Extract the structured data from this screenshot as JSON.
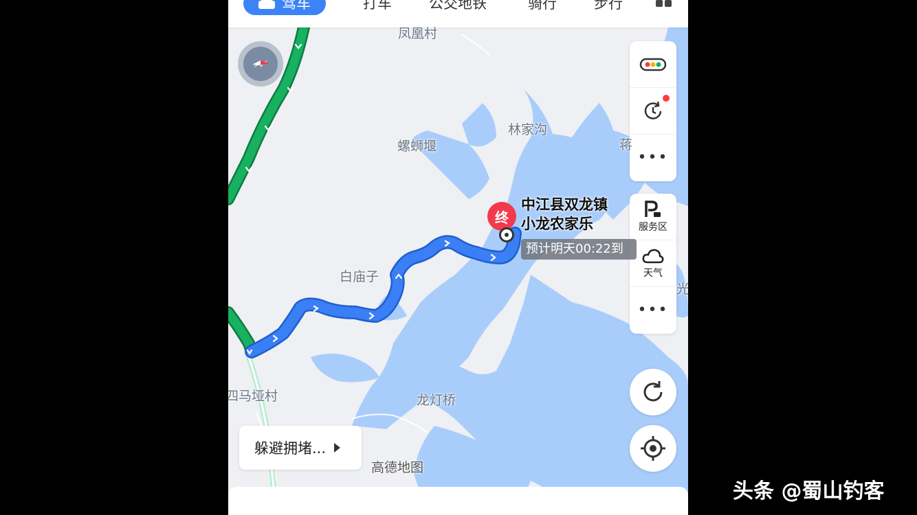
{
  "tabs": [
    {
      "label": "驾车",
      "active": true
    },
    {
      "label": "打车"
    },
    {
      "label": "公交地铁"
    },
    {
      "label": "骑行"
    },
    {
      "label": "步行"
    }
  ],
  "map_labels": {
    "fenghuang": "凤凰村",
    "linjiagou": "林家沟",
    "luoshiyan": "螺蛳堰",
    "jiang": "蒋",
    "baimiaozi": "白庙子",
    "guang": "光",
    "simayacun": "四马垭村",
    "longdengqiao": "龙灯桥",
    "gaode": "高德地图"
  },
  "destination": {
    "marker": "终",
    "name_line1": "中江县双龙镇",
    "name_line2": "小龙农家乐",
    "eta": "预计明天00:22到"
  },
  "tools": {
    "service_area": "服务区",
    "weather": "天气",
    "more": "•••"
  },
  "avoid_label": "躲避拥堵...",
  "watermark": "头条 @蜀山钓客",
  "colors": {
    "route_blue": "#3a7ff5",
    "route_green": "#14a85a",
    "water": "#a9cdfb",
    "accent": "#3d83f7"
  }
}
